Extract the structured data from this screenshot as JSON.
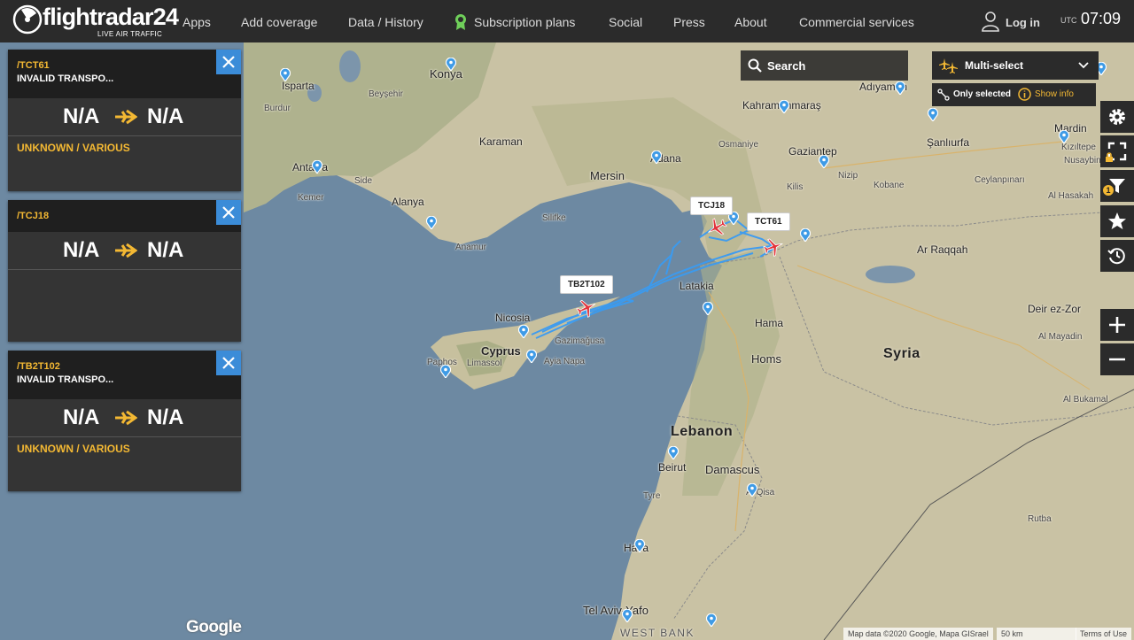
{
  "header": {
    "logo_text": "flightradar24",
    "logo_sub": "LIVE AIR TRAFFIC",
    "nav": [
      "Apps",
      "Add coverage",
      "Data / History",
      "Subscription plans",
      "Social",
      "Press",
      "About",
      "Commercial services"
    ],
    "login": "Log in",
    "utc_label": "UTC",
    "time": "07:09"
  },
  "panels": [
    {
      "callsign": "/TCT61",
      "type": "INVALID TRANSPO...",
      "from": "N/A",
      "to": "N/A",
      "airline": "UNKNOWN / VARIOUS"
    },
    {
      "callsign": "/TCJ18",
      "type": "",
      "from": "N/A",
      "to": "N/A",
      "airline": ""
    },
    {
      "callsign": "/TB2T102",
      "type": "INVALID TRANSPO...",
      "from": "N/A",
      "to": "N/A",
      "airline": "UNKNOWN / VARIOUS"
    }
  ],
  "controls": {
    "search": "Search",
    "multi_select": "Multi-select",
    "only_selected": "Only selected",
    "show_info": "Show info",
    "filter_count": "1"
  },
  "aircraft_labels": [
    "TB2T102",
    "TCJ18",
    "TCT61"
  ],
  "map": {
    "cities": [
      "Konya",
      "Isparta",
      "Beyşehir",
      "Burdur",
      "Karaman",
      "Mersin",
      "Adana",
      "Osmaniye",
      "Kahramanmaraş",
      "Gaziantep",
      "Adıyaman",
      "Şanlıurfa",
      "Mardin",
      "Kızıltepe",
      "Nusaybin",
      "Antalya",
      "Side",
      "Alanya",
      "Kemer",
      "Anamur",
      "Silifke",
      "Kilis",
      "Nizip",
      "Kobane",
      "Al Hasakah",
      "Ar Raqqah",
      "Latakia",
      "Hama",
      "Homs",
      "Deir ez-Zor",
      "Al Mayadin",
      "Al Bukamal",
      "Nicosia",
      "Cyprus",
      "Limassol",
      "Gazimağusa",
      "Ayia Napa",
      "Paphos",
      "Beirut",
      "Tyre",
      "Damascus",
      "Haifa",
      "Tel Aviv-Yafo",
      "Lebanon",
      "Syria",
      "WEST BANK",
      "Ceylanpınarı",
      "Rutba",
      "Al Qisa"
    ],
    "attribution": "Map data ©2020 Google, Mapa GISrael",
    "scale": "50 km",
    "terms": "Terms of Use",
    "google": "Google"
  }
}
